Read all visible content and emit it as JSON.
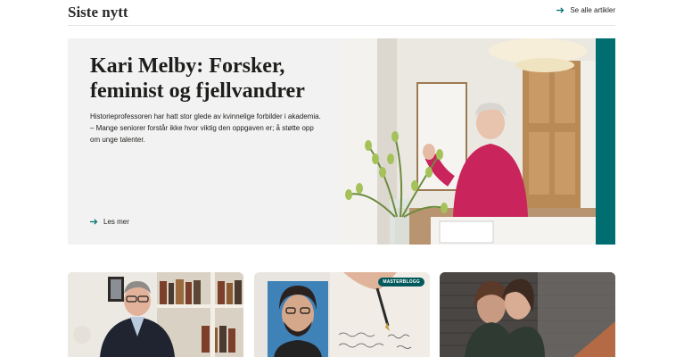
{
  "section": {
    "title": "Siste nytt",
    "see_all_label": "Se alle artikler"
  },
  "feature": {
    "title": "Kari Melby: Forsker, feminist og fjellvandrer",
    "summary": "Historieprofessoren har hatt stor glede av kvinnelige forbilder i akademia. – Mange seniorer forstår ikke hvor viktig den oppgaven er; å støtte opp om unge talenter.",
    "read_more_label": "Les mer",
    "accent_color": "#006e70"
  },
  "cards": [
    {
      "image": "man-in-library-photo"
    },
    {
      "image": "man-with-glasses-and-handwriting-photo",
      "badge": "MASTERBLOGG"
    },
    {
      "image": "two-people-embracing-photo"
    }
  ],
  "icons": {
    "see_all": "arrow-right-icon",
    "read_more": "arrow-right-icon"
  }
}
